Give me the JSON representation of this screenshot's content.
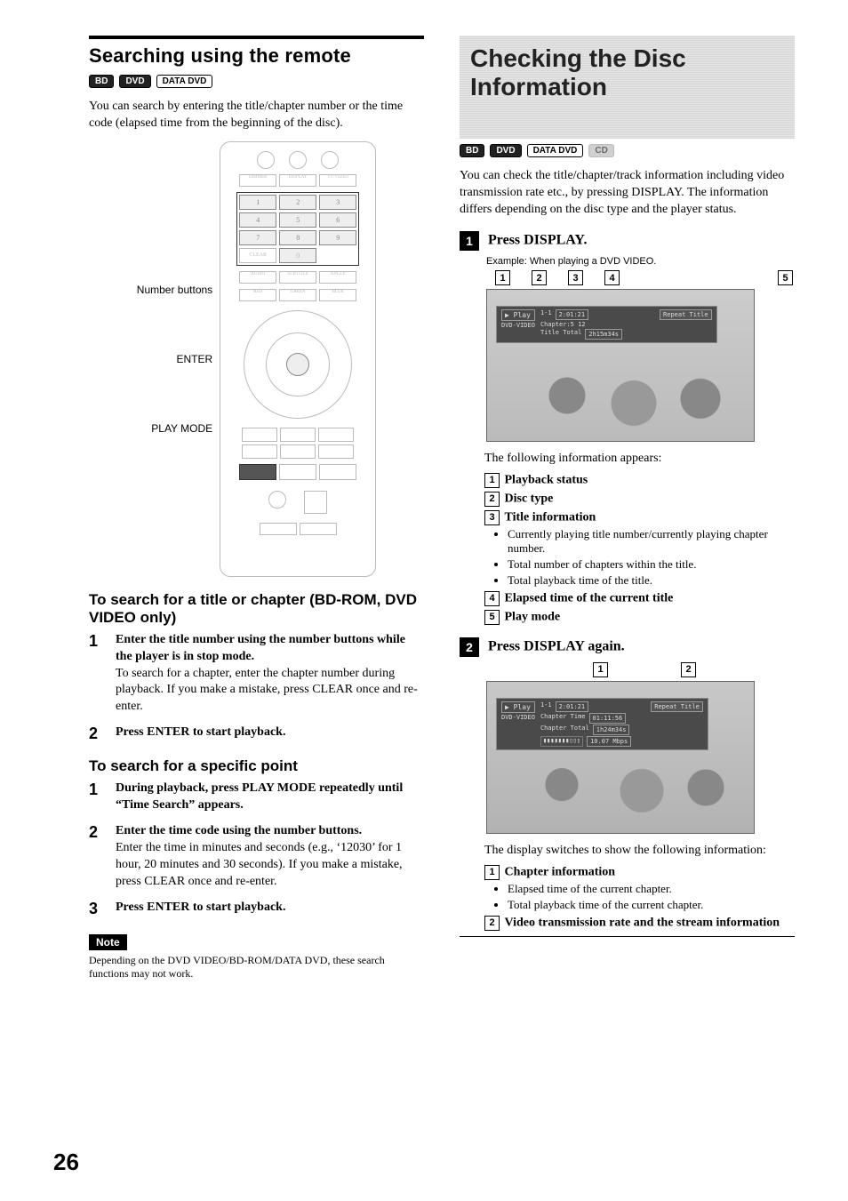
{
  "page_number": "26",
  "left": {
    "heading": "Searching using the remote",
    "badges": [
      "BD",
      "DVD",
      "DATA DVD"
    ],
    "intro": "You can search by entering the title/chapter number or the time code (elapsed time from the beginning of the disc).",
    "remote_labels": {
      "number_buttons": "Number buttons",
      "enter": "ENTER",
      "play_mode": "PLAY MODE"
    },
    "sub1_heading": "To search for a title or chapter (BD-ROM, DVD VIDEO only)",
    "sub1_steps": [
      {
        "n": "1",
        "lead": "Enter the title number using the number buttons while the player is in stop mode.",
        "rest": "To search for a chapter, enter the chapter number during playback. If you make a mistake, press CLEAR once and re-enter."
      },
      {
        "n": "2",
        "lead": "Press ENTER to start playback.",
        "rest": ""
      }
    ],
    "sub2_heading": "To search for a specific point",
    "sub2_steps": [
      {
        "n": "1",
        "lead": "During playback, press PLAY MODE repeatedly until “Time Search” appears.",
        "rest": ""
      },
      {
        "n": "2",
        "lead": "Enter the time code using the number buttons.",
        "rest": "Enter the time in minutes and seconds (e.g., ‘12030’ for 1 hour, 20 minutes and 30 seconds). If you make a mistake, press CLEAR once and re-enter."
      },
      {
        "n": "3",
        "lead": "Press ENTER to start playback.",
        "rest": ""
      }
    ],
    "note_label": "Note",
    "note_text": "Depending on the DVD VIDEO/BD-ROM/DATA DVD, these search functions may not work."
  },
  "right": {
    "banner": "Checking the Disc Information",
    "badges": [
      "BD",
      "DVD",
      "DATA DVD",
      "CD"
    ],
    "intro": "You can check the title/chapter/track information including video transmission rate etc., by pressing DISPLAY. The information differs depending on the disc type and the player status.",
    "step1_label": "1",
    "step1_text": "Press DISPLAY.",
    "example_label": "Example: When playing a DVD VIDEO.",
    "callouts_top": [
      "1",
      "2",
      "3",
      "4"
    ],
    "callout_top_right": "5",
    "osd1": {
      "play": "▶ Play",
      "disc": "DVD-VIDEO",
      "title_chapter": "1-1",
      "elapsed": "2:01:21",
      "chapters": "Chapter:5 12",
      "title_total": "Title Total",
      "total_time": "2h15m34s",
      "repeat": "Repeat Title"
    },
    "following_text": "The following information appears:",
    "info_items": [
      {
        "n": "1",
        "label": "Playback status"
      },
      {
        "n": "2",
        "label": "Disc type"
      },
      {
        "n": "3",
        "label": "Title information",
        "subs": [
          "Currently playing title number/currently playing chapter number.",
          "Total number of chapters within the title.",
          "Total playback time of the title."
        ]
      },
      {
        "n": "4",
        "label": "Elapsed time of the current title"
      },
      {
        "n": "5",
        "label": "Play mode"
      }
    ],
    "step2_label": "2",
    "step2_text": "Press DISPLAY again.",
    "callouts2": [
      "1",
      "2"
    ],
    "osd2": {
      "play": "▶ Play",
      "disc": "DVD-VIDEO",
      "line1a": "1-1",
      "line1b": "2:01:21",
      "line2a": "Chapter Time",
      "line2b": "01:11:56",
      "line3a": "Chapter Total",
      "line3b": "1h24m34s",
      "rate": "10.07 Mbps",
      "repeat": "Repeat Title"
    },
    "switch_text": "The display switches to show the following information:",
    "info_items2": [
      {
        "n": "1",
        "label": "Chapter information",
        "subs": [
          "Elapsed time of the current chapter.",
          "Total playback time of the current chapter."
        ]
      },
      {
        "n": "2",
        "label": "Video transmission rate and the stream information"
      }
    ]
  }
}
